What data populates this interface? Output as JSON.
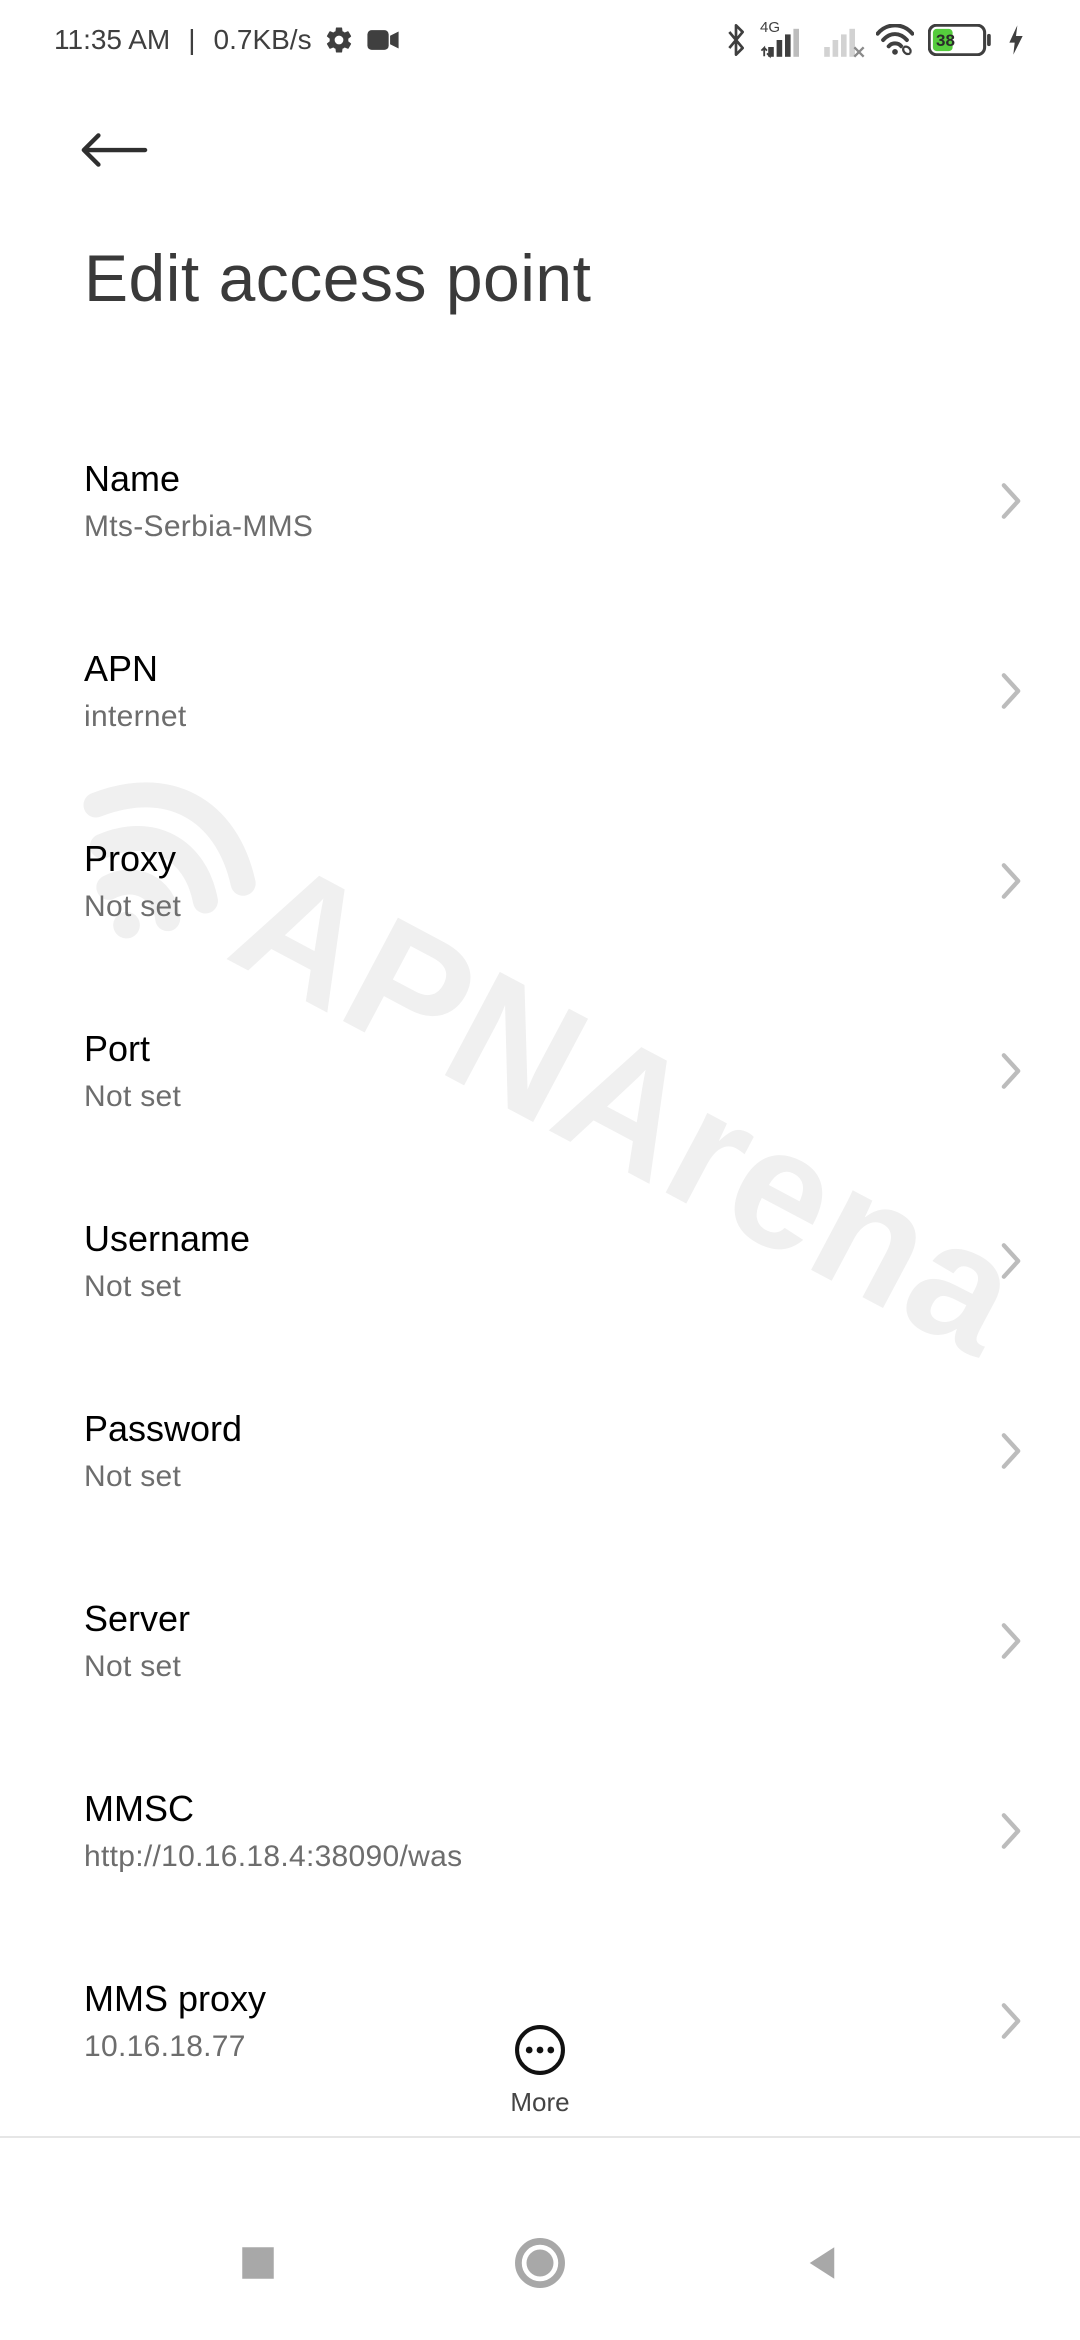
{
  "status": {
    "time": "11:35 AM",
    "net_rate": "0.7KB/s",
    "signal_tag": "4G",
    "battery_pct": "38"
  },
  "header": {
    "title": "Edit access point"
  },
  "settings": [
    {
      "label": "Name",
      "value": "Mts-Serbia-MMS"
    },
    {
      "label": "APN",
      "value": "internet"
    },
    {
      "label": "Proxy",
      "value": "Not set"
    },
    {
      "label": "Port",
      "value": "Not set"
    },
    {
      "label": "Username",
      "value": "Not set"
    },
    {
      "label": "Password",
      "value": "Not set"
    },
    {
      "label": "Server",
      "value": "Not set"
    },
    {
      "label": "MMSC",
      "value": "http://10.16.18.4:38090/was"
    },
    {
      "label": "MMS proxy",
      "value": "10.16.18.77"
    }
  ],
  "footer": {
    "more_label": "More"
  },
  "watermark_text": "APNArena"
}
